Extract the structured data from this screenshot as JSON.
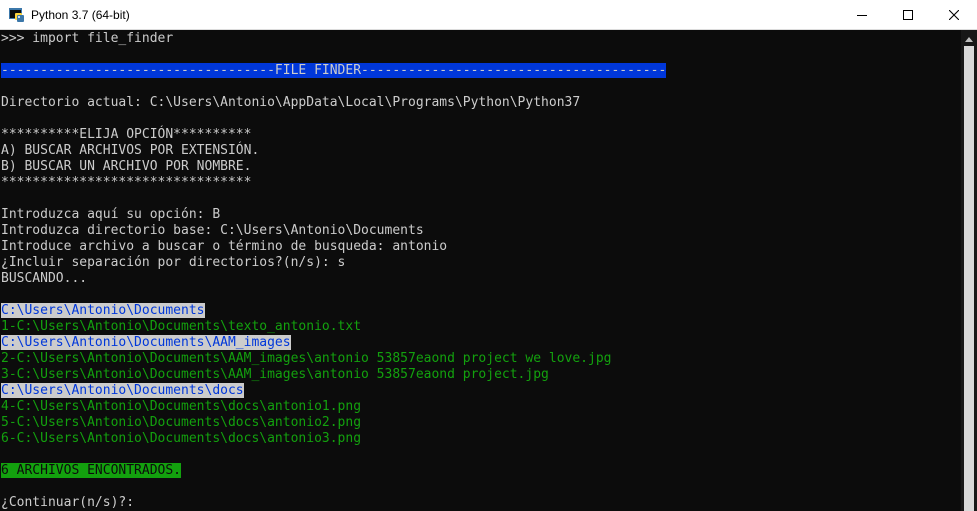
{
  "window": {
    "title": "Python 3.7 (64-bit)",
    "app_icon": "python-icon",
    "controls": {
      "minimize_icon": "minimize-icon",
      "maximize_icon": "maximize-icon",
      "close_icon": "close-icon"
    }
  },
  "colors": {
    "console_bg": "#0c0c0c",
    "console_text": "#cccccc",
    "highlight_blue": "#0037da",
    "highlight_white": "#cccccc",
    "green_text": "#13a10e",
    "green_bg": "#13a10e"
  },
  "console": {
    "lines": [
      ">>> import file_finder",
      "",
      "-----------------------------------FILE FINDER---------------------------------------",
      "",
      "Directorio actual: C:\\Users\\Antonio\\AppData\\Local\\Programs\\Python\\Python37",
      "",
      "**********ELIJA OPCIÓN**********",
      "A) BUSCAR ARCHIVOS POR EXTENSIÓN.",
      "B) BUSCAR UN ARCHIVO POR NOMBRE.",
      "********************************",
      "",
      "Introduzca aquí su opción: B",
      "Introduzca directorio base: C:\\Users\\Antonio\\Documents",
      "Introduce archivo a buscar o término de busqueda: antonio",
      "¿Incluir separación por directorios?(n/s): s",
      "BUSCANDO...",
      "",
      "C:\\Users\\Antonio\\Documents",
      "1-C:\\Users\\Antonio\\Documents\\texto_antonio.txt",
      "C:\\Users\\Antonio\\Documents\\AAM_images",
      "2-C:\\Users\\Antonio\\Documents\\AAM_images\\antonio 53857eaond project we love.jpg",
      "3-C:\\Users\\Antonio\\Documents\\AAM_images\\antonio 53857eaond project.jpg",
      "C:\\Users\\Antonio\\Documents\\docs",
      "4-C:\\Users\\Antonio\\Documents\\docs\\antonio1.png",
      "5-C:\\Users\\Antonio\\Documents\\docs\\antonio2.png",
      "6-C:\\Users\\Antonio\\Documents\\docs\\antonio3.png",
      "",
      "6 ARCHIVOS ENCONTRADOS.",
      "",
      "¿Continuar(n/s)?:"
    ]
  },
  "scrollbar": {
    "up_icon": "scroll-up-arrow-icon"
  }
}
